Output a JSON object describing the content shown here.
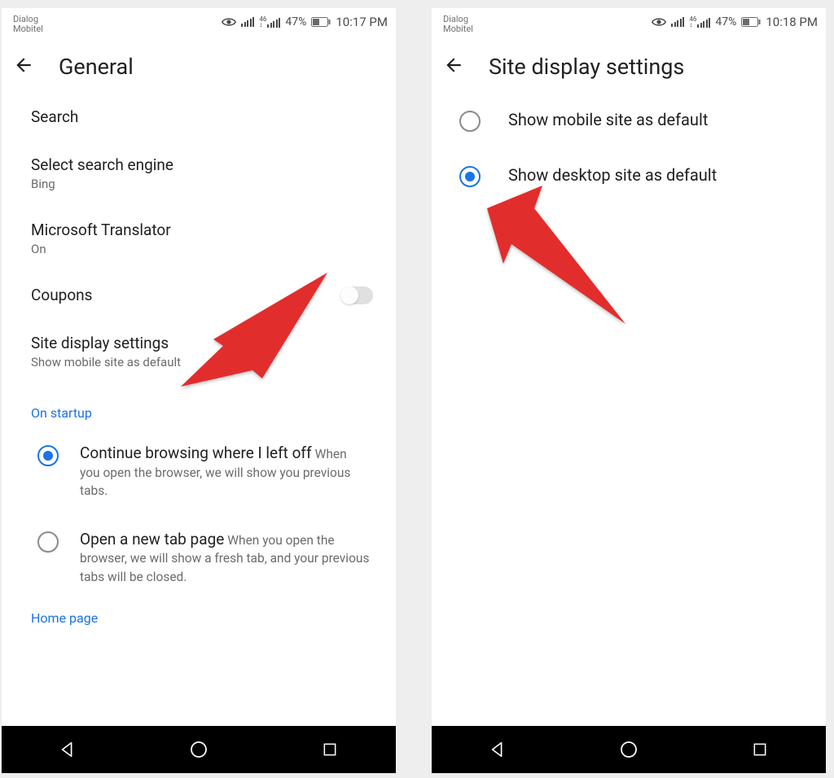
{
  "status": {
    "carrier_line1": "Dialog",
    "carrier_line2": "Mobitel",
    "battery": "47%",
    "time_left": "10:17 PM",
    "time_right": "10:18 PM"
  },
  "left": {
    "title": "General",
    "items": {
      "search": {
        "label": "Search"
      },
      "search_engine": {
        "label": "Select search engine",
        "value": "Bing"
      },
      "translator": {
        "label": "Microsoft Translator",
        "value": "On"
      },
      "coupons": {
        "label": "Coupons"
      },
      "site_display": {
        "label": "Site display settings",
        "value": "Show mobile site as default"
      }
    },
    "section1": "On startup",
    "startup": {
      "continue": {
        "label": "Continue browsing where I left off",
        "desc": "When you open the browser, we will show you previous tabs."
      },
      "newtab": {
        "label": "Open a new tab page",
        "desc": "When you open the browser, we will show a fresh tab, and your previous tabs will be closed."
      }
    },
    "section2": "Home page"
  },
  "right": {
    "title": "Site display settings",
    "options": {
      "mobile": "Show mobile site as default",
      "desktop": "Show desktop site as default"
    }
  }
}
